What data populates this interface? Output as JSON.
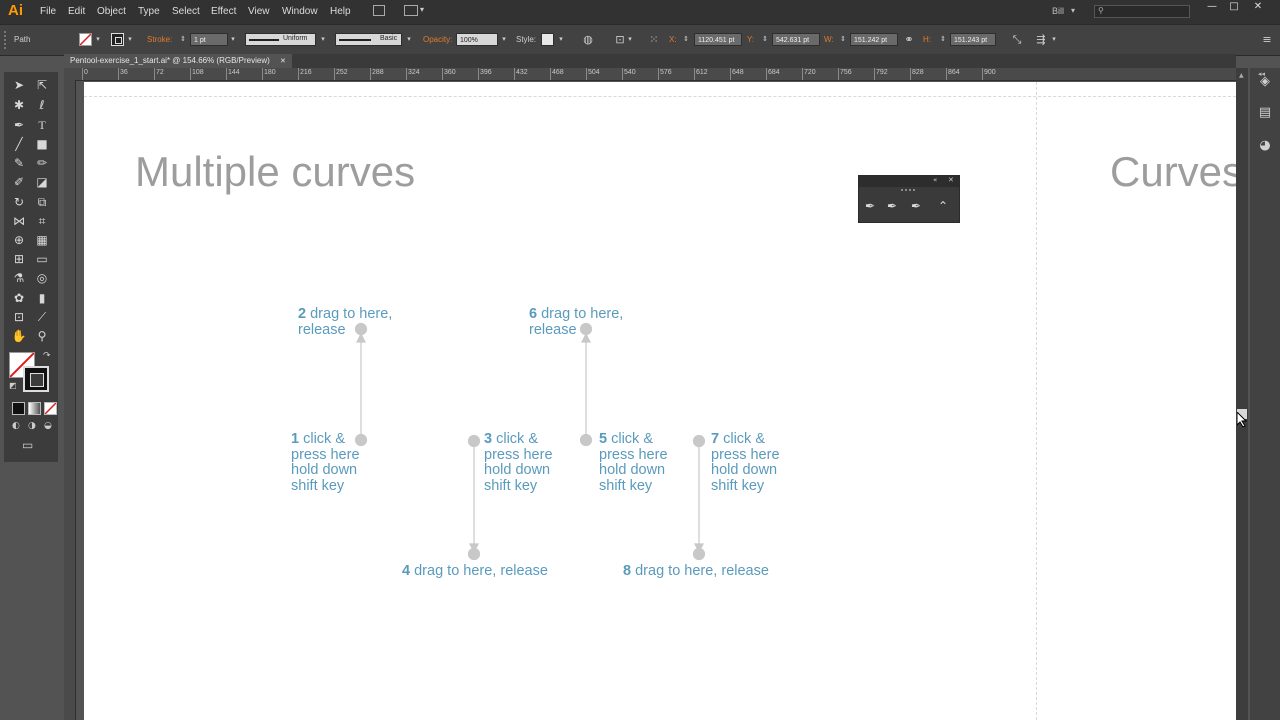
{
  "app": {
    "logo": "Ai"
  },
  "menu": [
    "File",
    "Edit",
    "Object",
    "Type",
    "Select",
    "Effect",
    "View",
    "Window",
    "Help"
  ],
  "user": {
    "name": "Bill",
    "dropdown": "▾"
  },
  "search": {
    "value": ""
  },
  "window_controls": {
    "minimize": "—",
    "maximize": "□",
    "close": "✕"
  },
  "control_bar": {
    "selection_label": "Path",
    "stroke_label": "Stroke:",
    "stroke_weight": "1 pt",
    "profile_label": "Uniform",
    "brush_label": "Basic",
    "opacity_label": "Opacity:",
    "opacity_value": "100%",
    "style_label": "Style:",
    "x_label": "X:",
    "x_value": "1120.451 pt",
    "y_label": "Y:",
    "y_value": "542.631 pt",
    "w_label": "W:",
    "w_value": "151.242 pt",
    "h_label": "H:",
    "h_value": "151.243 pt"
  },
  "document": {
    "tab_title": "Pentool-exercise_1_start.ai* @ 154.66% (RGB/Preview)",
    "tab_close": "✕"
  },
  "ruler_ticks": [
    "0",
    "36",
    "72",
    "108",
    "144",
    "180",
    "216",
    "252",
    "288",
    "324",
    "360",
    "396",
    "432",
    "468",
    "504",
    "540",
    "576",
    "612",
    "648",
    "684",
    "720",
    "756",
    "792",
    "828",
    "864",
    "900"
  ],
  "artboard": {
    "title_left": "Multiple curves",
    "title_right": "Curves"
  },
  "instructions": [
    {
      "num": "2",
      "text": "drag to here,",
      "line2": "release"
    },
    {
      "num": "6",
      "text": "drag to here,",
      "line2": "release"
    },
    {
      "num": "1",
      "text": "click &",
      "line2": "press here",
      "line3": "hold down",
      "line4": "shift key"
    },
    {
      "num": "3",
      "text": "click &",
      "line2": "press here",
      "line3": "hold down",
      "line4": "shift key"
    },
    {
      "num": "5",
      "text": "click &",
      "line2": "press here",
      "line3": "hold down",
      "line4": "shift key"
    },
    {
      "num": "7",
      "text": "click &",
      "line2": "press here",
      "line3": "hold down",
      "line4": "shift key"
    },
    {
      "num": "4",
      "text": "drag to here, release"
    },
    {
      "num": "8",
      "text": "drag to here, release"
    }
  ],
  "colors": {
    "accent_orange": "#ff9a00",
    "instruction_blue": "#5a9bbd",
    "guide_gray": "#c8c8c8",
    "title_gray": "#9d9d9d"
  },
  "icons": {
    "toolbar": [
      "selection-tool-icon",
      "direct-selection-tool-icon",
      "magic-wand-tool-icon",
      "lasso-tool-icon",
      "pen-tool-icon",
      "type-tool-icon",
      "line-tool-icon",
      "rectangle-tool-icon",
      "paintbrush-tool-icon",
      "pencil-tool-icon",
      "blob-brush-tool-icon",
      "eraser-tool-icon",
      "rotate-tool-icon",
      "scale-tool-icon",
      "width-tool-icon",
      "free-transform-tool-icon",
      "shape-builder-tool-icon",
      "perspective-grid-tool-icon",
      "mesh-tool-icon",
      "gradient-tool-icon",
      "eyedropper-tool-icon",
      "blend-tool-icon",
      "symbol-sprayer-tool-icon",
      "column-graph-tool-icon",
      "artboard-tool-icon",
      "slice-tool-icon",
      "hand-tool-icon",
      "zoom-tool-icon"
    ],
    "dock": [
      "layers-icon",
      "libraries-icon",
      "appearance-icon"
    ]
  }
}
